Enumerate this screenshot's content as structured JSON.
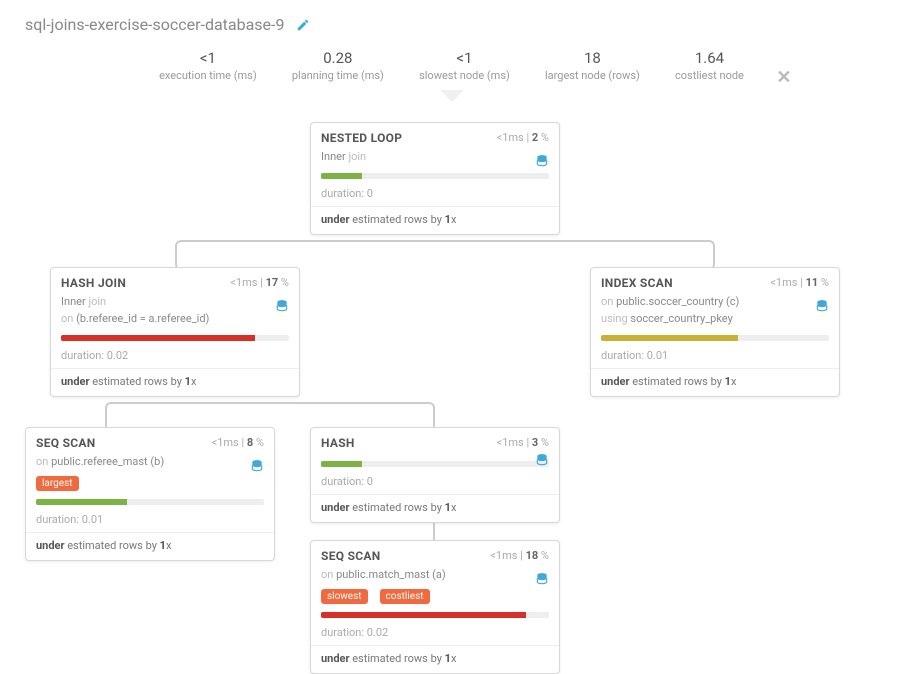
{
  "header": {
    "title": "sql-joins-exercise-soccer-database-9"
  },
  "stats": {
    "execution": {
      "value": "<1",
      "label": "execution time (ms)"
    },
    "planning": {
      "value": "0.28",
      "label": "planning time (ms)"
    },
    "slowest": {
      "value": "<1",
      "label": "slowest node (ms)"
    },
    "largest": {
      "value": "18",
      "label": "largest node (rows)"
    },
    "costliest": {
      "value": "1.64",
      "label": "costliest node"
    }
  },
  "nodes": {
    "nested_loop": {
      "title": "NESTED LOOP",
      "time": "<1ms",
      "pct": "2",
      "sub1": "Inner",
      "sub1dim": "join",
      "bar_color": "green",
      "bar_pct": 18,
      "duration": "duration: 0",
      "estimate_pre": "under",
      "estimate_mid": " estimated rows by ",
      "estimate_x": "1",
      "estimate_suf": "x"
    },
    "hash_join": {
      "title": "HASH JOIN",
      "time": "<1ms",
      "pct": "17",
      "sub1": "Inner",
      "sub1dim": "join",
      "sub2pre": "on ",
      "sub2": "(b.referee_id = a.referee_id)",
      "bar_color": "red",
      "bar_pct": 85,
      "duration": "duration: 0.02",
      "estimate_pre": "under",
      "estimate_mid": " estimated rows by ",
      "estimate_x": "1",
      "estimate_suf": "x"
    },
    "index_scan": {
      "title": "INDEX SCAN",
      "time": "<1ms",
      "pct": "11",
      "sub1pre": "on ",
      "sub1": "public.soccer_country (c)",
      "sub2pre": "using ",
      "sub2": "soccer_country_pkey",
      "bar_color": "yellow",
      "bar_pct": 60,
      "duration": "duration: 0.01",
      "estimate_pre": "under",
      "estimate_mid": " estimated rows by ",
      "estimate_x": "1",
      "estimate_suf": "x"
    },
    "seq_scan_b": {
      "title": "SEQ SCAN",
      "time": "<1ms",
      "pct": "8",
      "sub1pre": "on ",
      "sub1": "public.referee_mast (b)",
      "badge1": "largest",
      "bar_color": "green",
      "bar_pct": 40,
      "duration": "duration: 0.01",
      "estimate_pre": "under",
      "estimate_mid": " estimated rows by ",
      "estimate_x": "1",
      "estimate_suf": "x"
    },
    "hash": {
      "title": "HASH",
      "time": "<1ms",
      "pct": "3",
      "bar_color": "green",
      "bar_pct": 18,
      "duration": "duration: 0",
      "estimate_pre": "under",
      "estimate_mid": " estimated rows by ",
      "estimate_x": "1",
      "estimate_suf": "x"
    },
    "seq_scan_a": {
      "title": "SEQ SCAN",
      "time": "<1ms",
      "pct": "18",
      "sub1pre": "on ",
      "sub1": "public.match_mast (a)",
      "badge1": "slowest",
      "badge2": "costliest",
      "bar_color": "red",
      "bar_pct": 90,
      "duration": "duration: 0.02",
      "estimate_pre": "under",
      "estimate_mid": " estimated rows by ",
      "estimate_x": "1",
      "estimate_suf": "x"
    }
  }
}
